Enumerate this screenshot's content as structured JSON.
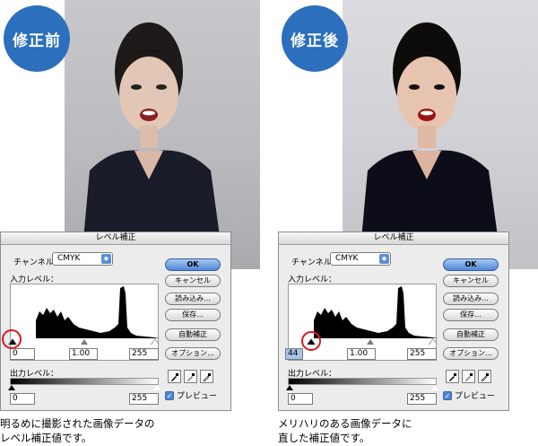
{
  "panels": [
    {
      "badge": "修正前",
      "dialog": {
        "title": "レベル補正",
        "channel_label": "チャンネル：",
        "channel_value": "CMYK",
        "input_label": "入力レベル：",
        "input_values": [
          "0",
          "1.00",
          "255"
        ],
        "output_label": "出力レベル：",
        "output_values": [
          "0",
          "255"
        ],
        "buttons": [
          "OK",
          "キャンセル",
          "読み込み...",
          "保存...",
          "自動補正",
          "オプション..."
        ],
        "preview_label": "プレビュー"
      },
      "caption_lines": [
        "明るめに撮影された画像データの",
        "レベル補正値です。"
      ]
    },
    {
      "badge": "修正後",
      "dialog": {
        "title": "レベル補正",
        "channel_label": "チャンネル：",
        "channel_value": "CMYK",
        "input_label": "入力レベル：",
        "input_values": [
          "44",
          "1.00",
          "255"
        ],
        "output_label": "出力レベル：",
        "output_values": [
          "0",
          "255"
        ],
        "buttons": [
          "OK",
          "キャンセル",
          "読み込み...",
          "保存...",
          "自動補正",
          "オプション..."
        ],
        "preview_label": "プレビュー"
      },
      "caption_lines": [
        "メリハリのある画像データに",
        "直した補正値です。"
      ]
    }
  ],
  "icons": [
    "eyedropper-black-icon",
    "eyedropper-gray-icon",
    "eyedropper-white-icon",
    "checkbox-checked-icon",
    "popup-arrow-icon"
  ],
  "colors": {
    "badge": "#2b6fbd",
    "ok_button": "#4f86d5",
    "highlight_ring": "#e0161d"
  }
}
